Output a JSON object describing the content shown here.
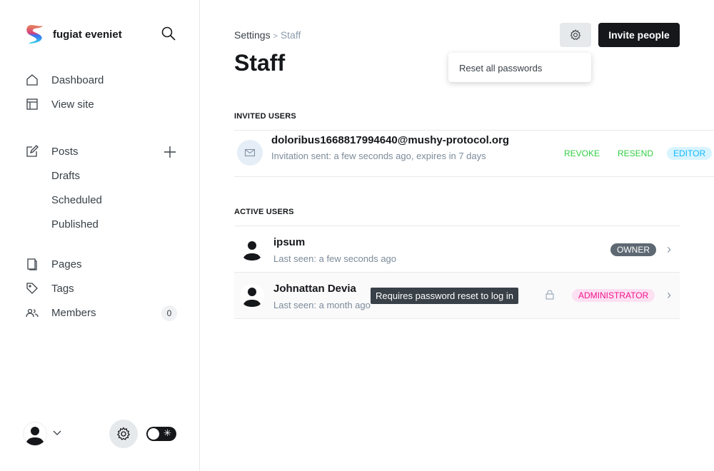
{
  "brand": {
    "name": "fugiat eveniet"
  },
  "nav": {
    "dashboard": "Dashboard",
    "view_site": "View site",
    "posts": "Posts",
    "drafts": "Drafts",
    "scheduled": "Scheduled",
    "published": "Published",
    "pages": "Pages",
    "tags": "Tags",
    "members": "Members",
    "members_count": "0"
  },
  "header": {
    "breadcrumb_parent": "Settings",
    "breadcrumb_sep": ">",
    "breadcrumb_current": "Staff",
    "title": "Staff",
    "invite_label": "Invite people",
    "menu_item": "Reset all passwords"
  },
  "invited": {
    "heading": "INVITED USERS",
    "email": "doloribus1668817994640@mushy-protocol.org",
    "meta": "Invitation sent: a few seconds ago, expires in 7 days",
    "revoke": "REVOKE",
    "resend": "RESEND",
    "role": "EDITOR"
  },
  "active": {
    "heading": "ACTIVE USERS",
    "users": [
      {
        "name": "ipsum",
        "meta": "Last seen: a few seconds ago",
        "role": "OWNER"
      },
      {
        "name": "Johnattan Devia",
        "meta": "Last seen: a month ago",
        "role": "ADMINISTRATOR"
      }
    ],
    "tooltip": "Requires password reset to log in"
  },
  "colors": {
    "accent": "#30cf43",
    "editor_bg": "#d8f4ff",
    "editor_fg": "#14b8ff",
    "admin_bg": "#fde0f2",
    "admin_fg": "#f0148c",
    "owner_bg": "#5e6873"
  }
}
